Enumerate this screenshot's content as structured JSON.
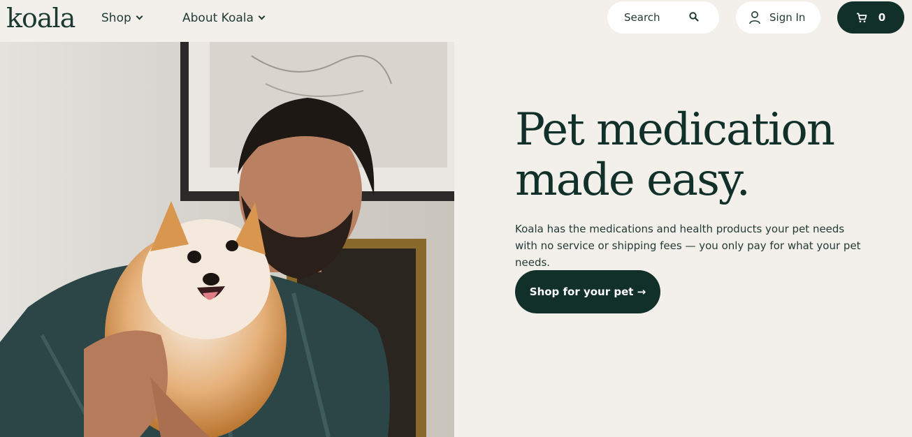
{
  "header": {
    "logo": "koala",
    "nav": [
      {
        "label": "Shop"
      },
      {
        "label": "About Koala"
      }
    ],
    "search_label": "Search",
    "signin_label": "Sign In",
    "cart_count": "0",
    "icons": [
      "chevron-down-icon",
      "search-icon",
      "user-icon",
      "cart-icon"
    ]
  },
  "hero": {
    "headline_line1": "Pet medication",
    "headline_line2": "made easy.",
    "description": "Koala has the medications and health products your pet needs with no service or shipping fees — you only pay for what your pet needs.",
    "cta_label": "Shop for your pet →"
  },
  "colors": {
    "background": "#f3f0eb",
    "brand_dark": "#12302a",
    "white": "#ffffff"
  }
}
